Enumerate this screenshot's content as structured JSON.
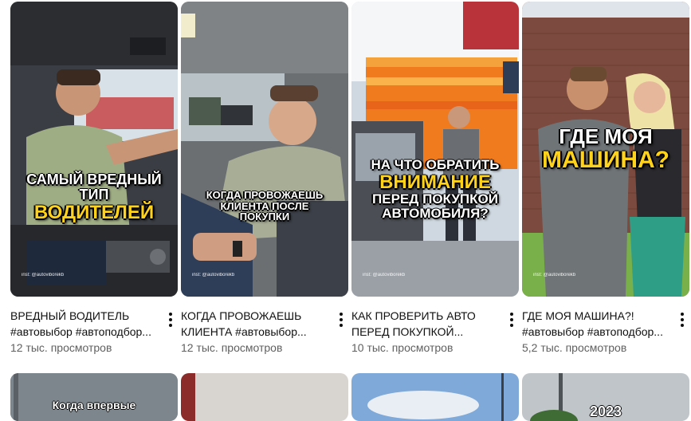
{
  "videos": [
    {
      "title_line1": "ВРЕДНЫЙ ВОДИТЕЛЬ",
      "title_line2": "#автовыбор #автоподбор...",
      "views": "12 тыс. просмотров",
      "caption_white": "САМЫЙ ВРЕДНЫЙ ТИП",
      "caption_yellow": "ВОДИТЕЛЕЙ",
      "watermark": "inst: @autoviborekb"
    },
    {
      "title_line1": "КОГДА ПРОВОЖАЕШЬ",
      "title_line2": "КЛИЕНТА #автовыбор...",
      "views": "12 тыс. просмотров",
      "caption_white": "КОГДА ПРОВОЖАЕШЬ КЛИЕНТА ПОСЛЕ ПОКУПКИ",
      "watermark": "inst: @autoviborekb"
    },
    {
      "title_line1": "КАК ПРОВЕРИТЬ АВТО",
      "title_line2": "ПЕРЕД ПОКУПКОЙ...",
      "views": "10 тыс. просмотров",
      "caption_line1": "НА ЧТО ОБРАТИТЬ",
      "caption_yellow": "ВНИМАНИЕ",
      "caption_line3": "ПЕРЕД ПОКУПКОЙ",
      "caption_line4": "АВТОМОБИЛЯ?",
      "watermark": "inst: @autoviborekb"
    },
    {
      "title_line1": "ГДЕ МОЯ МАШИНА?!",
      "title_line2": "#автовыбор #автоподбор...",
      "views": "5,2 тыс. просмотров",
      "caption_white": "ГДЕ МОЯ",
      "caption_yellow": "МАШИНА?",
      "watermark": "inst: @autoviborekb"
    }
  ],
  "bottom_row": [
    {
      "caption": "Когда впервые"
    },
    {
      "caption": ""
    },
    {
      "caption": ""
    },
    {
      "caption": "2023"
    }
  ],
  "colors": {
    "title": "#0f0f0f",
    "meta": "#606060",
    "caption_yellow": "#ffd21c"
  }
}
